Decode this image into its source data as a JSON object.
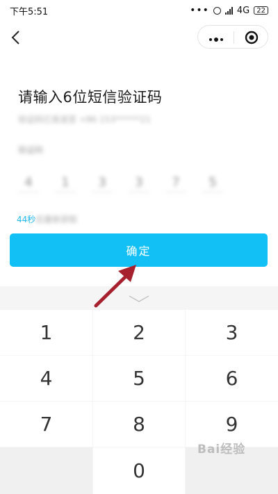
{
  "status_bar": {
    "time": "下午5:51",
    "dots": "•••",
    "network": "4G",
    "battery": "22"
  },
  "page": {
    "title": "请输入6位短信验证码",
    "phone_hint": "验证码已发送至 +86 153******21",
    "code_label": "验证码",
    "code_digits": [
      "4",
      "1",
      "3",
      "3",
      "7",
      "5"
    ],
    "resend_seconds": "44秒",
    "resend_text": "后重新获取",
    "confirm_label": "确定"
  },
  "keyboard": {
    "keys": [
      "1",
      "2",
      "3",
      "4",
      "5",
      "6",
      "7",
      "8",
      "9",
      "",
      "0",
      ""
    ]
  },
  "watermark": "Bai经验",
  "colors": {
    "accent": "#12c0f5",
    "arrow": "#a6202e"
  }
}
